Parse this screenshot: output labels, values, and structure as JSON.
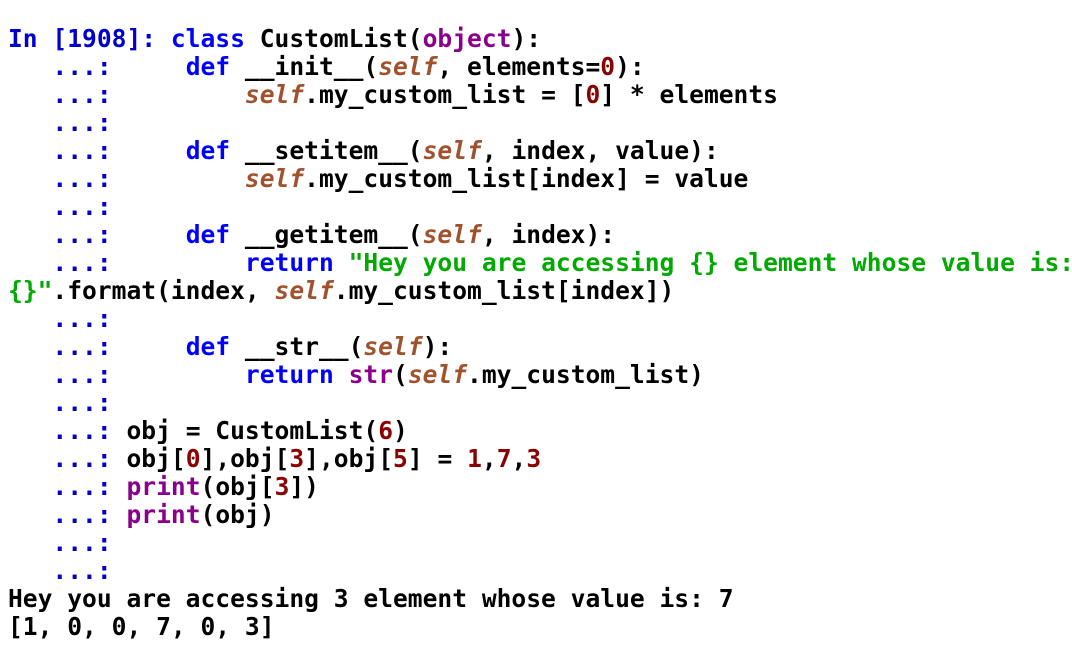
{
  "colors": {
    "prompt": "#0000cc",
    "keyword": "#0000ff",
    "builtin": "#8b008b",
    "self": "#a0522d",
    "number": "#8b0000",
    "string": "#00aa00",
    "output": "#000000",
    "background": "#ffffff"
  },
  "lines": [
    {
      "name": "input-line-1",
      "tokens": [
        {
          "t": "In [1908]: ",
          "c": "prompt"
        },
        {
          "t": "class",
          "c": "kw"
        },
        {
          "t": " CustomList(",
          "c": ""
        },
        {
          "t": "object",
          "c": "builtin"
        },
        {
          "t": "):",
          "c": ""
        }
      ]
    },
    {
      "name": "input-line-2",
      "tokens": [
        {
          "t": "   ...:     ",
          "c": "prompt"
        },
        {
          "t": "def",
          "c": "kw"
        },
        {
          "t": " __init__(",
          "c": ""
        },
        {
          "t": "self",
          "c": "self"
        },
        {
          "t": ", elements=",
          "c": ""
        },
        {
          "t": "0",
          "c": "num"
        },
        {
          "t": "):",
          "c": ""
        }
      ]
    },
    {
      "name": "input-line-3",
      "tokens": [
        {
          "t": "   ...:         ",
          "c": "prompt"
        },
        {
          "t": "self",
          "c": "self"
        },
        {
          "t": ".my_custom_list = [",
          "c": ""
        },
        {
          "t": "0",
          "c": "num"
        },
        {
          "t": "] * elements",
          "c": ""
        }
      ]
    },
    {
      "name": "input-line-4",
      "tokens": [
        {
          "t": "   ...:",
          "c": "prompt"
        }
      ]
    },
    {
      "name": "input-line-5",
      "tokens": [
        {
          "t": "   ...:     ",
          "c": "prompt"
        },
        {
          "t": "def",
          "c": "kw"
        },
        {
          "t": " __setitem__(",
          "c": ""
        },
        {
          "t": "self",
          "c": "self"
        },
        {
          "t": ", index, value):",
          "c": ""
        }
      ]
    },
    {
      "name": "input-line-6",
      "tokens": [
        {
          "t": "   ...:         ",
          "c": "prompt"
        },
        {
          "t": "self",
          "c": "self"
        },
        {
          "t": ".my_custom_list[index] = value",
          "c": ""
        }
      ]
    },
    {
      "name": "input-line-7",
      "tokens": [
        {
          "t": "   ...:",
          "c": "prompt"
        }
      ]
    },
    {
      "name": "input-line-8",
      "tokens": [
        {
          "t": "   ...:     ",
          "c": "prompt"
        },
        {
          "t": "def",
          "c": "kw"
        },
        {
          "t": " __getitem__(",
          "c": ""
        },
        {
          "t": "self",
          "c": "self"
        },
        {
          "t": ", index):",
          "c": ""
        }
      ]
    },
    {
      "name": "input-line-9",
      "tokens": [
        {
          "t": "   ...:         ",
          "c": "prompt"
        },
        {
          "t": "return",
          "c": "kw"
        },
        {
          "t": " ",
          "c": ""
        },
        {
          "t": "\"Hey you are accessing {} element whose value is:",
          "c": "str"
        }
      ]
    },
    {
      "name": "input-line-10",
      "tokens": [
        {
          "t": "{}\"",
          "c": "str"
        },
        {
          "t": ".format(index, ",
          "c": ""
        },
        {
          "t": "self",
          "c": "self"
        },
        {
          "t": ".my_custom_list[index])",
          "c": ""
        }
      ]
    },
    {
      "name": "input-line-11",
      "tokens": [
        {
          "t": "   ...:",
          "c": "prompt"
        }
      ]
    },
    {
      "name": "input-line-12",
      "tokens": [
        {
          "t": "   ...:     ",
          "c": "prompt"
        },
        {
          "t": "def",
          "c": "kw"
        },
        {
          "t": " __str__(",
          "c": ""
        },
        {
          "t": "self",
          "c": "self"
        },
        {
          "t": "):",
          "c": ""
        }
      ]
    },
    {
      "name": "input-line-13",
      "tokens": [
        {
          "t": "   ...:         ",
          "c": "prompt"
        },
        {
          "t": "return",
          "c": "kw"
        },
        {
          "t": " ",
          "c": ""
        },
        {
          "t": "str",
          "c": "builtin"
        },
        {
          "t": "(",
          "c": ""
        },
        {
          "t": "self",
          "c": "self"
        },
        {
          "t": ".my_custom_list)",
          "c": ""
        }
      ]
    },
    {
      "name": "input-line-14",
      "tokens": [
        {
          "t": "   ...:",
          "c": "prompt"
        }
      ]
    },
    {
      "name": "input-line-15",
      "tokens": [
        {
          "t": "   ...: ",
          "c": "prompt"
        },
        {
          "t": "obj = CustomList(",
          "c": ""
        },
        {
          "t": "6",
          "c": "num"
        },
        {
          "t": ")",
          "c": ""
        }
      ]
    },
    {
      "name": "input-line-16",
      "tokens": [
        {
          "t": "   ...: ",
          "c": "prompt"
        },
        {
          "t": "obj[",
          "c": ""
        },
        {
          "t": "0",
          "c": "num"
        },
        {
          "t": "],obj[",
          "c": ""
        },
        {
          "t": "3",
          "c": "num"
        },
        {
          "t": "],obj[",
          "c": ""
        },
        {
          "t": "5",
          "c": "num"
        },
        {
          "t": "] = ",
          "c": ""
        },
        {
          "t": "1",
          "c": "num"
        },
        {
          "t": ",",
          "c": ""
        },
        {
          "t": "7",
          "c": "num"
        },
        {
          "t": ",",
          "c": ""
        },
        {
          "t": "3",
          "c": "num"
        }
      ]
    },
    {
      "name": "input-line-17",
      "tokens": [
        {
          "t": "   ...: ",
          "c": "prompt"
        },
        {
          "t": "print",
          "c": "builtin"
        },
        {
          "t": "(obj[",
          "c": ""
        },
        {
          "t": "3",
          "c": "num"
        },
        {
          "t": "])",
          "c": ""
        }
      ]
    },
    {
      "name": "input-line-18",
      "tokens": [
        {
          "t": "   ...: ",
          "c": "prompt"
        },
        {
          "t": "print",
          "c": "builtin"
        },
        {
          "t": "(obj)",
          "c": ""
        }
      ]
    },
    {
      "name": "input-line-19",
      "tokens": [
        {
          "t": "   ...:",
          "c": "prompt"
        }
      ]
    },
    {
      "name": "input-line-20",
      "tokens": [
        {
          "t": "   ...:",
          "c": "prompt"
        }
      ]
    },
    {
      "name": "output-line-1",
      "tokens": [
        {
          "t": "Hey you are accessing 3 element whose value is: 7",
          "c": "out"
        }
      ]
    },
    {
      "name": "output-line-2",
      "tokens": [
        {
          "t": "[1, 0, 0, 7, 0, 3]",
          "c": "out"
        }
      ]
    }
  ]
}
